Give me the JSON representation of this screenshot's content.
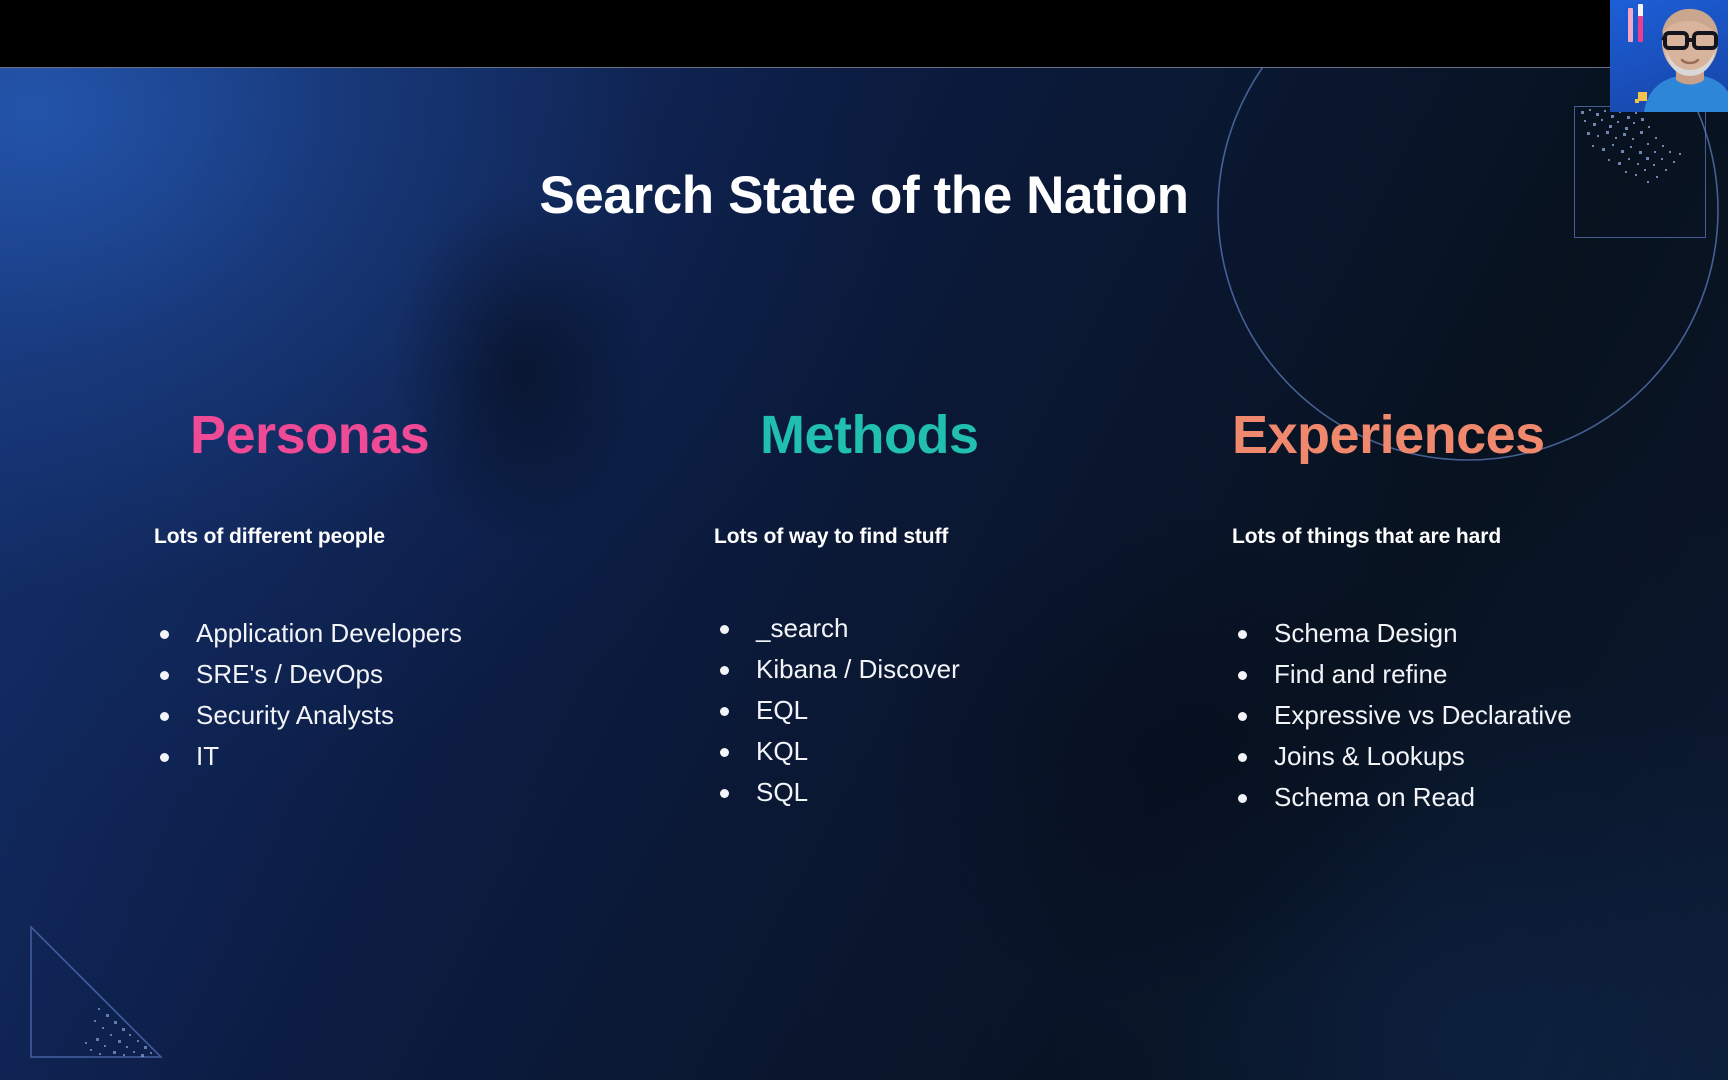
{
  "slide": {
    "title": "Search State of the Nation",
    "background_gradient_from": "#16347A",
    "background_gradient_to": "#08121F",
    "columns": [
      {
        "heading": "Personas",
        "heading_color": "#EE4A96",
        "subheading": "Lots of different people",
        "bullets": [
          "Application Developers",
          "SRE's / DevOps",
          "Security Analysts",
          "IT"
        ]
      },
      {
        "heading": "Methods",
        "heading_color": "#20BFB0",
        "subheading": "Lots of way to find stuff",
        "bullets": [
          "_search",
          "Kibana / Discover",
          "EQL",
          "KQL",
          "SQL"
        ]
      },
      {
        "heading": "Experiences",
        "heading_color": "#F0886E",
        "subheading": "Lots of things that are hard",
        "bullets": [
          "Schema Design",
          "Find and refine",
          "Expressive vs Declarative",
          "Joins & Lookups",
          "Schema on Read"
        ]
      }
    ],
    "decorations": [
      {
        "name": "circle-arc-outline",
        "color": "#6A8ED6"
      },
      {
        "name": "square-outline",
        "color": "#6A8ED6"
      },
      {
        "name": "triangle-outline",
        "color": "#5C7CC4"
      }
    ]
  },
  "webcam": {
    "label": "presenter-camera",
    "background_color": "#1C5FD6",
    "shirt_color": "#2E86D8"
  }
}
